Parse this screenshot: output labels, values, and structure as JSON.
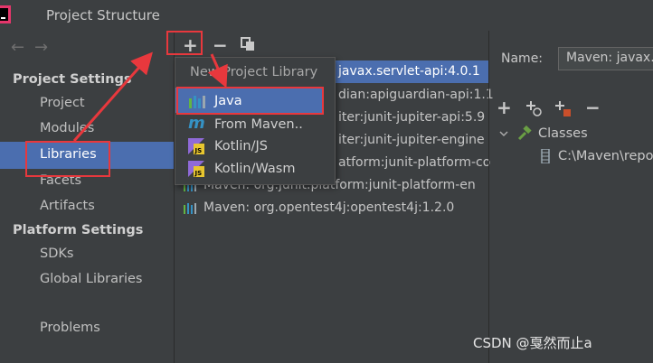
{
  "window": {
    "title": "Project Structure"
  },
  "toolbar": {
    "add": "+",
    "remove": "−"
  },
  "nav": {
    "back": "←",
    "forward": "→",
    "project_settings": "Project Settings",
    "project_items": [
      "Project",
      "Modules",
      "Libraries",
      "Facets",
      "Artifacts"
    ],
    "platform_settings": "Platform Settings",
    "platform_items": [
      "SDKs",
      "Global Libraries"
    ],
    "problems": "Problems",
    "selected": "Libraries"
  },
  "libraries": [
    "javax.servlet-api:4.0.1",
    "dian:apiguardian-api:1.1",
    "iter:junit-jupiter-api:5.9",
    "iter:junit-jupiter-engine",
    "atform:junit-platform-co",
    "Maven: org.junit.platform:junit-platform-en",
    "Maven: org.opentest4j:opentest4j:1.2.0"
  ],
  "popup": {
    "title": "New Project Library",
    "items": [
      "Java",
      "From Maven..",
      "Kotlin/JS",
      "Kotlin/Wasm"
    ],
    "selected": "Java",
    "icons": [
      "library-icon",
      "maven-icon",
      "kotlin-js-icon",
      "kotlin-js-icon"
    ]
  },
  "detail": {
    "name_label": "Name:",
    "name_value": "Maven: javax.",
    "tree_root": "Classes",
    "tree_child": "C:\\Maven\\repo"
  },
  "watermark": "CSDN @戛然而止a",
  "colors": {
    "selection": "#4b6eaf",
    "annotation": "#e8383d",
    "background": "#3c3f41"
  }
}
